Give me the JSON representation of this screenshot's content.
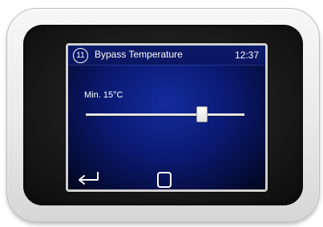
{
  "header": {
    "step_number": "11",
    "title": "Bypass Temperature",
    "time": "12:37"
  },
  "setting": {
    "label": "Min. 15°C",
    "slider_fraction": 0.73
  },
  "footer": {
    "back_icon": "back-arrow-icon",
    "home_icon": "square-home-icon"
  },
  "colors": {
    "screen_blue": "#0a1a72",
    "text": "#ffffff"
  }
}
